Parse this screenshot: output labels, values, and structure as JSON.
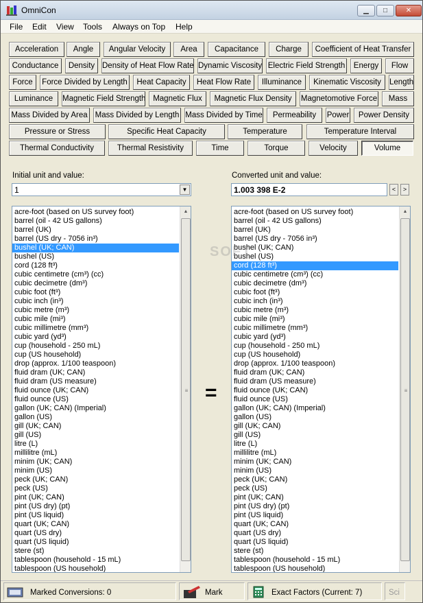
{
  "window": {
    "title": "OmniCon"
  },
  "menu": [
    "File",
    "Edit",
    "View",
    "Tools",
    "Always on Top",
    "Help"
  ],
  "categories": [
    [
      "Acceleration",
      "Angle",
      "Angular Velocity",
      "Area",
      "Capacitance",
      "Charge",
      "Coefficient of Heat Transfer"
    ],
    [
      "Conductance",
      "Density",
      "Density of Heat Flow Rate",
      "Dynamic Viscosity",
      "Electric Field Strength",
      "Energy",
      "Flow"
    ],
    [
      "Force",
      "Force Divided by Length",
      "Heat Capacity",
      "Heat Flow Rate",
      "Illuminance",
      "Kinematic Viscosity",
      "Length"
    ],
    [
      "Luminance",
      "Magnetic Field Strength",
      "Magnetic Flux",
      "Magnetic Flux Density",
      "Magnetomotive Force",
      "Mass"
    ],
    [
      "Mass Divided by Area",
      "Mass Divided by Length",
      "Mass Divided by Time",
      "Permeability",
      "Power",
      "Power Density"
    ],
    [
      "Pressure or Stress",
      "Specific Heat Capacity",
      "Temperature",
      "Temperature Interval"
    ],
    [
      "Thermal Conductivity",
      "Thermal Resistivity",
      "Time",
      "Torque",
      "Velocity",
      "Volume"
    ]
  ],
  "selected_category": "Volume",
  "initial": {
    "label": "Initial unit and value:",
    "value": "1"
  },
  "converted": {
    "label": "Converted unit and value:",
    "value": "1.003 398 E-2"
  },
  "equals": "=",
  "units": [
    "acre-foot (based on US survey foot)",
    "barrel (oil - 42 US gallons)",
    "barrel (UK)",
    "barrel (US dry - 7056 in³)",
    "bushel (UK; CAN)",
    "bushel (US)",
    "cord (128 ft³)",
    "cubic centimetre (cm³) (cc)",
    "cubic decimetre (dm³)",
    "cubic foot (ft³)",
    "cubic inch (in³)",
    "cubic metre (m³)",
    "cubic mile (mi³)",
    "cubic millimetre (mm³)",
    "cubic yard (yd³)",
    "cup (household - 250 mL)",
    "cup (US household)",
    "drop (approx. 1/100 teaspoon)",
    "fluid dram (UK; CAN)",
    "fluid dram (US measure)",
    "fluid ounce (UK; CAN)",
    "fluid ounce (US)",
    "gallon (UK; CAN) (Imperial)",
    "gallon (US)",
    "gill (UK; CAN)",
    "gill (US)",
    "litre (L)",
    "millilitre (mL)",
    "minim (UK; CAN)",
    "minim (US)",
    "peck (UK; CAN)",
    "peck (US)",
    "pint (UK; CAN)",
    "pint (US dry) (pt)",
    "pint (US liquid)",
    "quart (UK; CAN)",
    "quart (US dry)",
    "quart (US liquid)",
    "stere (st)",
    "tablespoon (household - 15 mL)",
    "tablespoon (US household)"
  ],
  "left_selected_index": 4,
  "right_selected_index": 6,
  "status": {
    "marked": "Marked Conversions: 0",
    "mark": "Mark",
    "exact": "Exact Factors  (Current: 7)",
    "sci": "Sci"
  },
  "watermark": "SOFT",
  "colors": {
    "selection": "#3399ff",
    "face": "#ece9d8"
  }
}
